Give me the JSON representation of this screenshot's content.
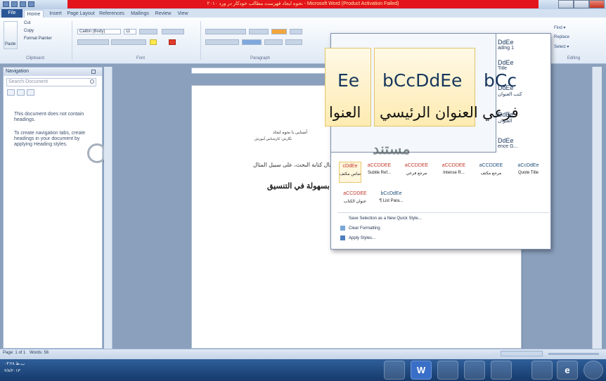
{
  "window": {
    "title": "نحوه ایجاد فهرست مطالب خودکار در ورد ۲۰۱۰ - Microsoft Word (Product Activation Failed)"
  },
  "tabs": [
    "File",
    "Home",
    "Insert",
    "Page Layout",
    "References",
    "Mailings",
    "Review",
    "View"
  ],
  "ribbon": {
    "clipboard": {
      "paste": "Paste",
      "cut": "Cut",
      "copy": "Copy",
      "format_painter": "Format Painter",
      "label": "Clipboard"
    },
    "font": {
      "name": "Calibri (Body)",
      "size": "11",
      "label": "Font"
    },
    "paragraph": {
      "label": "Paragraph"
    },
    "editing": {
      "find": "Find ▾",
      "replace": "Replace",
      "select": "Select ▾",
      "label": "Editing"
    }
  },
  "navigation": {
    "title": "Navigation",
    "search_placeholder": "Search Document",
    "msg1": "This document does not contain headings.",
    "msg2": "To create navigation tabs, create headings in your document by applying Heading styles."
  },
  "document": {
    "line1": "آشنایی با نحوه ایجاد",
    "line2": "نگارش: کارشناس آموزش",
    "line3": "فرض کنید که در حال کتابة البحث، على سبيل المثال",
    "line4": "و تنظيمها بسهولة في التنسيق"
  },
  "styles_gallery": {
    "zoom": {
      "sample": "bCcDdEe",
      "left_sample": "Ee",
      "left_arabic": "العنوا",
      "center_arabic": "العنوان الرئيسي",
      "right_sample": "bCc",
      "right_arabic": "فرعي",
      "blur_text": "مستند"
    },
    "side_items": [
      {
        "sample": "DdEe",
        "name": "ading 1"
      },
      {
        "sample": "DdEe",
        "name": "Title"
      },
      {
        "sample": "DdEe",
        "name": "كتب العنوان"
      },
      {
        "sample": "DdEe",
        "name": "العنوان"
      },
      {
        "sample": "DdEe",
        "name": "ence G..."
      }
    ],
    "row1": [
      {
        "sample": "aCcDdEe",
        "name": "Quote Title"
      },
      {
        "sample": "aCCDDEE",
        "name": "مرجع مكثف"
      },
      {
        "sample": "aCCDDEE",
        "name": "Intense R..."
      },
      {
        "sample": "aCCDDEE",
        "name": "مرجع فرعي"
      },
      {
        "sample": "aCCDDEE",
        "name": "Subtle Ref..."
      },
      {
        "sample": "cDdEe",
        "name": "اقتباس مكثف"
      }
    ],
    "row2": [
      {
        "sample": "bCcDdEe",
        "name": "¶ List Para..."
      },
      {
        "sample": "aCCDDEE",
        "name": "عنوان الكتاب"
      }
    ],
    "menu": [
      {
        "label": "Save Selection as a New Quick Style..."
      },
      {
        "label": "Clear Formatting"
      },
      {
        "label": "Apply Styles..."
      }
    ]
  },
  "status": {
    "page": "Page: 1 of 1",
    "words": "Words: 56"
  },
  "taskbar": {
    "time": "۰۳:۲۸ ب.ظ",
    "date": "۲/۸/۲۰۱۳"
  },
  "colors": {
    "title_red": "#e3141b",
    "file_tab": "#2b5797",
    "taskbar": "#1f4a80"
  }
}
